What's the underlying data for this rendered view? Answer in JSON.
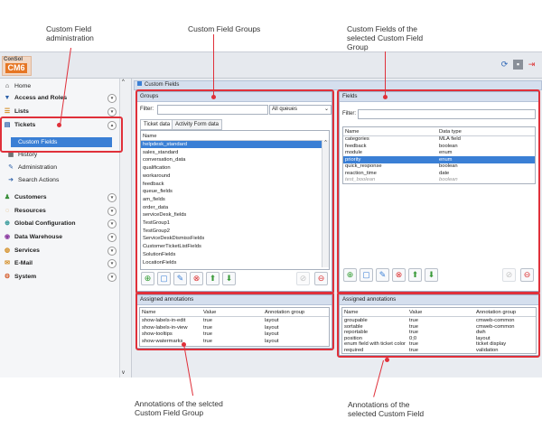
{
  "callouts": {
    "admin": "Custom Field\nadministration",
    "groups": "Custom Field Groups",
    "fields": "Custom Fields of the\nselected Custom Field\nGroup",
    "group_annotations": "Annotations of the selcted\nCustom Field Group",
    "field_annotations": "Annotations of the\nselected Custom Field"
  },
  "logo": {
    "top": "ConSol",
    "badge": "CM6"
  },
  "sidebar": {
    "home": "Home",
    "items": [
      {
        "label": "Access and Roles"
      },
      {
        "label": "Lists"
      },
      {
        "label": "Tickets"
      }
    ],
    "sub": [
      "Custom Fields",
      "History",
      "Administration",
      "Search Actions"
    ],
    "items2": [
      {
        "label": "Customers"
      },
      {
        "label": "Resources"
      },
      {
        "label": "Global Configuration"
      },
      {
        "label": "Data Warehouse"
      },
      {
        "label": "Services"
      },
      {
        "label": "E-Mail"
      },
      {
        "label": "System"
      }
    ]
  },
  "main_title": "Custom Fields",
  "groups": {
    "title": "Groups",
    "filter_label": "Filter:",
    "queue_select": "All queues",
    "tabs": [
      "Ticket data",
      "Activity Form data"
    ],
    "col": "Name",
    "rows": [
      "helpdesk_standard",
      "sales_standard",
      "conversation_data",
      "qualification",
      "workaround",
      "feedback",
      "queue_fields",
      "am_fields",
      "order_data",
      "serviceDesk_fields",
      "TestGroup1",
      "TestGroup2",
      "ServiceDeskDismissFields",
      "CustomerTicketListFields",
      "SolutionFields",
      "LocationFields"
    ]
  },
  "fields": {
    "title": "Fields",
    "filter_label": "Filter:",
    "cols": [
      "Name",
      "Data type"
    ],
    "rows": [
      [
        "categories",
        "MLA field"
      ],
      [
        "feedback",
        "boolean"
      ],
      [
        "module",
        "enum"
      ],
      [
        "priority",
        "enum"
      ],
      [
        "quick_response",
        "boolean"
      ],
      [
        "reaction_time",
        "date"
      ],
      [
        "test_boolean",
        "boolean"
      ]
    ]
  },
  "group_ann": {
    "title": "Assigned annotations",
    "cols": [
      "Name",
      "Value",
      "Annotation group"
    ],
    "rows": [
      [
        "show-labels-in-edit",
        "true",
        "layout"
      ],
      [
        "show-labels-in-view",
        "true",
        "layout"
      ],
      [
        "show-tooltips",
        "true",
        "layout"
      ],
      [
        "show-watermarks",
        "true",
        "layout"
      ]
    ]
  },
  "field_ann": {
    "title": "Assigned annotations",
    "cols": [
      "Name",
      "Value",
      "Annotation group"
    ],
    "rows": [
      [
        "groupable",
        "true",
        "cmweb-common"
      ],
      [
        "sortable",
        "true",
        "cmweb-common"
      ],
      [
        "reportable",
        "true",
        "dwh"
      ],
      [
        "position",
        "0;0",
        "layout"
      ],
      [
        "enum field with ticket color",
        "true",
        "ticket display"
      ],
      [
        "required",
        "true",
        "validation"
      ]
    ]
  }
}
